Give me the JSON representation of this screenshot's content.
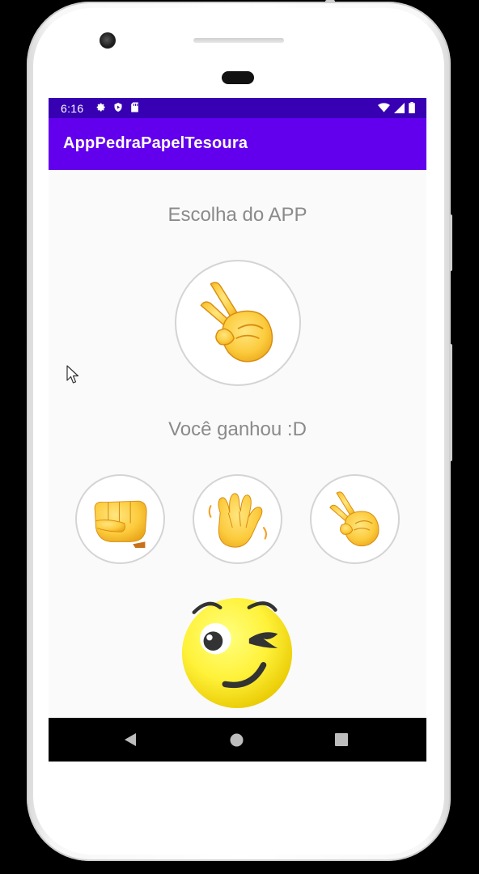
{
  "status_bar": {
    "time": "6:16",
    "left_icons": [
      "settings-icon",
      "shield-icon",
      "sd-card-icon"
    ],
    "right_icons": [
      "wifi-icon",
      "signal-icon",
      "battery-icon"
    ],
    "color": "#3700b3"
  },
  "app_bar": {
    "title": "AppPedraPapelTesoura",
    "color": "#6200ee"
  },
  "main": {
    "app_choice_label": "Escolha do APP",
    "app_choice_image": "victory-hand-emoji",
    "result_text": "Você ganhou :D",
    "options": [
      {
        "name": "pedra",
        "icon": "fist-emoji"
      },
      {
        "name": "papel",
        "icon": "waving-hand-emoji"
      },
      {
        "name": "tesoura",
        "icon": "victory-hand-emoji"
      }
    ],
    "result_image": "winking-face-emoji"
  },
  "nav_bar": {
    "buttons": [
      "back-icon",
      "home-icon",
      "recents-icon"
    ]
  }
}
